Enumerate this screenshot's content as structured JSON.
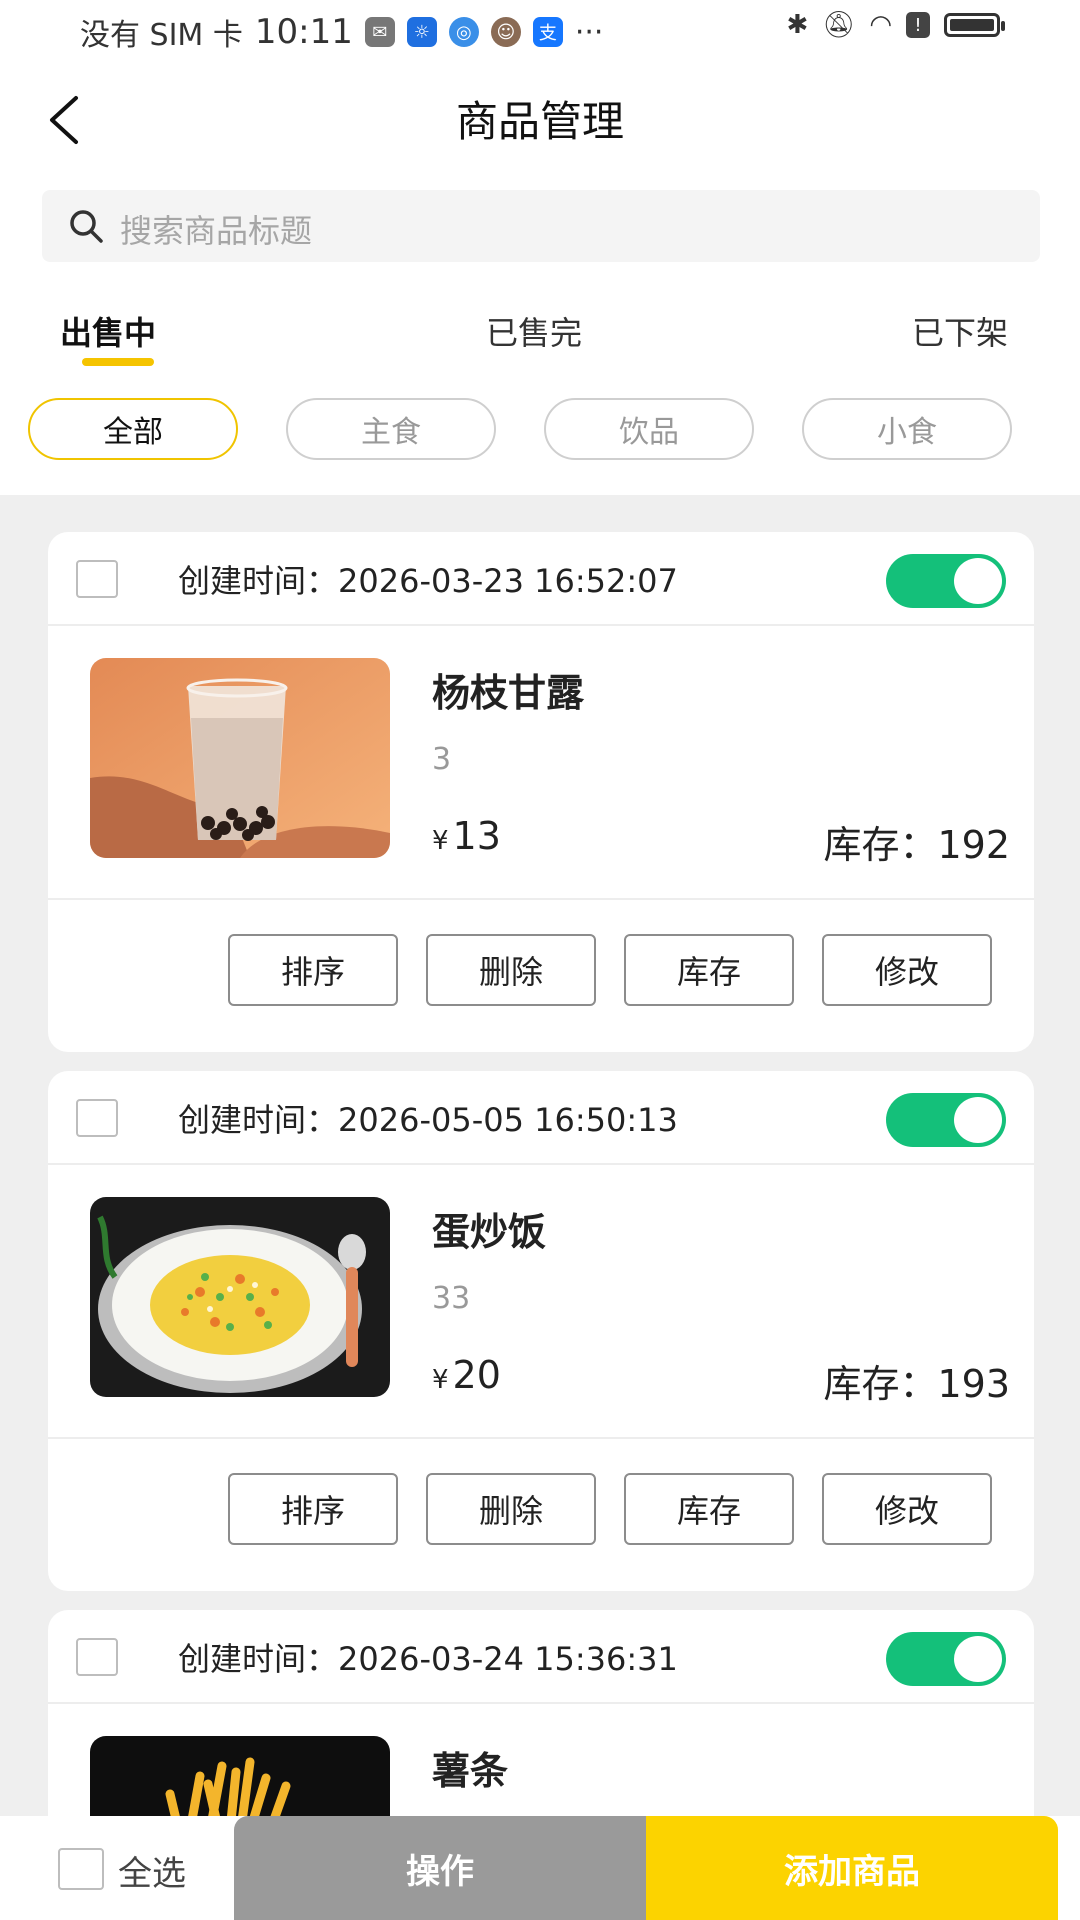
{
  "status_bar": {
    "carrier": "没有 SIM 卡",
    "time": "10:11",
    "app_icons": [
      "wechat-icon",
      "bulb-app-icon",
      "globe-app-icon",
      "avatar-app-icon",
      "alipay-icon"
    ],
    "more": "···"
  },
  "header": {
    "title": "商品管理"
  },
  "search": {
    "placeholder": "搜索商品标题"
  },
  "tabs": [
    {
      "label": "出售中",
      "active": true
    },
    {
      "label": "已售完",
      "active": false
    },
    {
      "label": "已下架",
      "active": false
    }
  ],
  "categories": [
    {
      "label": "全部",
      "active": true
    },
    {
      "label": "主食",
      "active": false
    },
    {
      "label": "饮品",
      "active": false
    },
    {
      "label": "小食",
      "active": false
    }
  ],
  "products": [
    {
      "created_label": "创建时间：",
      "created_time": "2026-03-23 16:52:07",
      "name": "杨枝甘露",
      "desc": "3",
      "currency": "¥",
      "price": "13",
      "stock_label": "库存：",
      "stock": "192",
      "enabled": true
    },
    {
      "created_label": "创建时间：",
      "created_time": "2026-05-05 16:50:13",
      "name": "蛋炒饭",
      "desc": "33",
      "currency": "¥",
      "price": "20",
      "stock_label": "库存：",
      "stock": "193",
      "enabled": true
    },
    {
      "created_label": "创建时间：",
      "created_time": "2026-03-24 15:36:31",
      "name": "薯条",
      "enabled": true
    }
  ],
  "card_actions": {
    "sort": "排序",
    "delete": "删除",
    "stock": "库存",
    "edit": "修改"
  },
  "bottom_bar": {
    "select_all": "全选",
    "operate": "操作",
    "add": "添加商品"
  },
  "colors": {
    "accent_yellow": "#fcd300",
    "toggle_green": "#14c07a",
    "operate_gray": "#9a9a9a"
  }
}
